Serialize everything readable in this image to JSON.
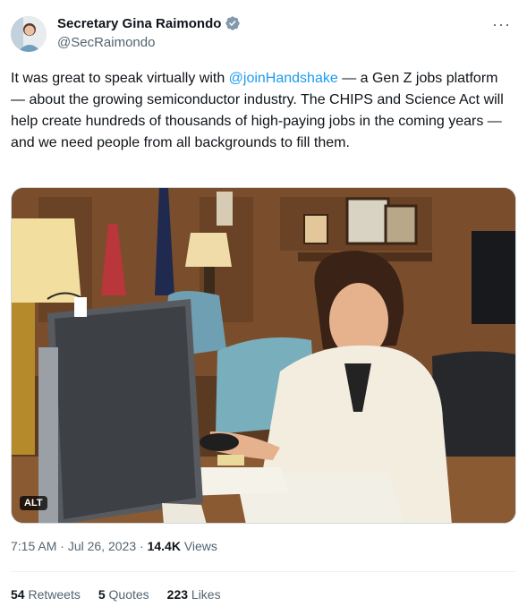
{
  "author": {
    "display_name": "Secretary Gina Raimondo",
    "handle": "@SecRaimondo"
  },
  "tweet": {
    "text_before": "It was great to speak virtually with ",
    "mention": "@joinHandshake",
    "text_after": " — a Gen Z jobs platform — about the growing semiconductor industry. The CHIPS and Science Act will help create hundreds of thousands of high-paying jobs in the coming years — and we need people from all backgrounds to fill them."
  },
  "media": {
    "alt_badge": "ALT"
  },
  "meta": {
    "time": "7:15 AM",
    "sep1": "·",
    "date": "Jul 26, 2023",
    "sep2": "·",
    "views_count": "14.4K",
    "views_label": "Views"
  },
  "stats": {
    "retweets_count": "54",
    "retweets_label": "Retweets",
    "quotes_count": "5",
    "quotes_label": "Quotes",
    "likes_count": "223",
    "likes_label": "Likes"
  },
  "colors": {
    "link": "#1d9bf0",
    "text": "#0f1419",
    "muted": "#536471",
    "verified": "#829aab"
  },
  "icons": [
    "verified-badge-icon",
    "more-options-icon"
  ]
}
